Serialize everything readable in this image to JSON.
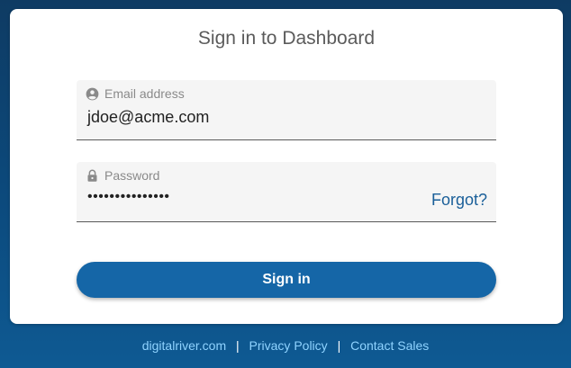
{
  "login": {
    "title": "Sign in to Dashboard",
    "email": {
      "label": "Email address",
      "value": "jdoe@acme.com",
      "icon": "account-circle-icon"
    },
    "password": {
      "label": "Password",
      "value": "•••••••••••••••",
      "icon": "lock-icon",
      "forgot_label": "Forgot?"
    },
    "signin_label": "Sign in"
  },
  "footer": {
    "links": [
      "digitalriver.com",
      "Privacy Policy",
      "Contact Sales"
    ],
    "separator": "|"
  },
  "colors": {
    "accent": "#1566a7",
    "link": "#1a5f99",
    "footer_link": "#8fd3ff",
    "background": "#0c4a7d"
  }
}
